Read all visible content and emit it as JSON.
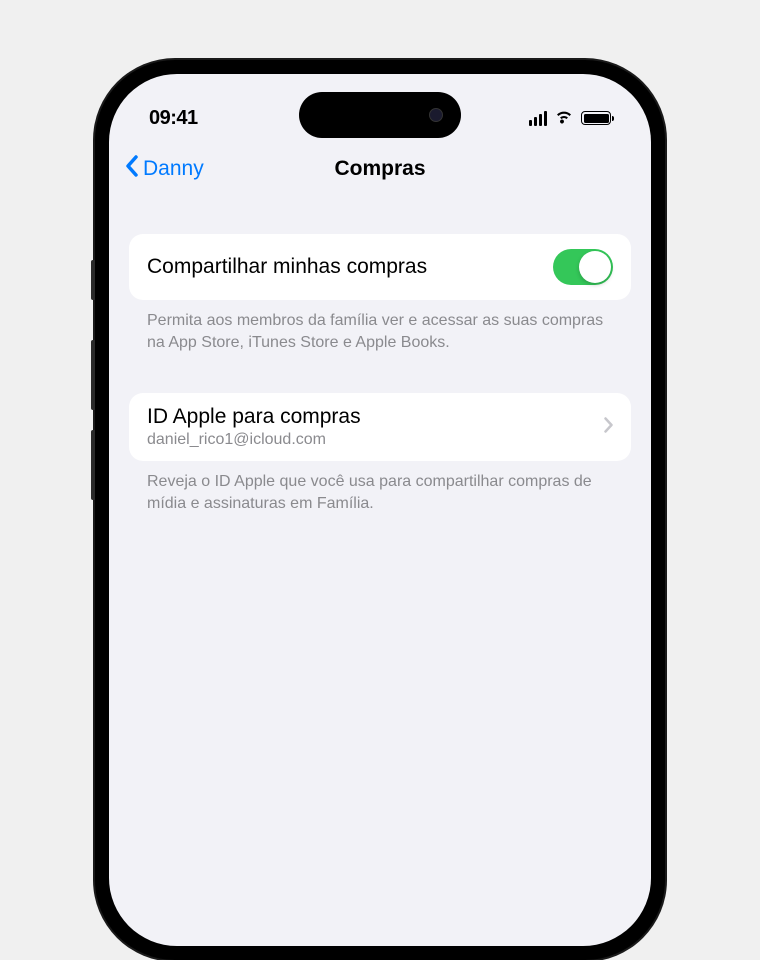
{
  "status": {
    "time": "09:41"
  },
  "nav": {
    "back_label": "Danny",
    "title": "Compras"
  },
  "share": {
    "label": "Compartilhar minhas compras",
    "toggle_on": true,
    "footer": "Permita aos membros da família ver e acessar as suas compras na App Store, iTunes Store e Apple Books."
  },
  "appleid": {
    "title": "ID Apple para compras",
    "email": "daniel_rico1@icloud.com",
    "footer": "Reveja o ID Apple que você usa para compartilhar compras de mídia e assinaturas em Família."
  },
  "colors": {
    "link": "#007aff",
    "toggle_on": "#34c759",
    "background": "#f2f2f7"
  }
}
